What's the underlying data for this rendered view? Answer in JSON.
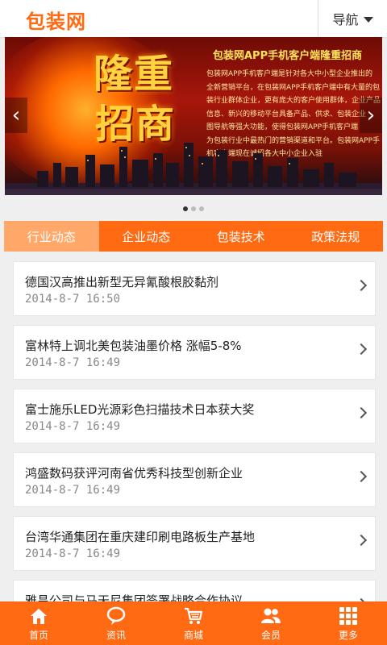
{
  "header": {
    "logo_text": "包装网",
    "nav_label": "导航"
  },
  "banner": {
    "headline_line1": "隆重",
    "headline_line2": "招商",
    "title": "包装网APP手机客户端隆重招商",
    "body": "包装网APP手机客户端是针对各大中小型企业推出的\n全新营销平台，在包装网APP手机客户端中有大量的包\n装行业群体企业，更有庞大的客户使用群体，企业产品\n信息、新兴的移动平台具备产品、供求、包装企业\n图导航等强大功能，使得包装网APP手机客户端\n为包装行业中最热门的营销渠道和平台。包装网APP手\n机客户端现在诚招各大中小企业入驻"
  },
  "tabs": [
    {
      "label": "行业动态",
      "active": true
    },
    {
      "label": "企业动态",
      "active": false
    },
    {
      "label": "包装技术",
      "active": false
    },
    {
      "label": "政策法规",
      "active": false
    }
  ],
  "news": [
    {
      "title": "德国汉高推出新型无异氰酸根胶黏剂",
      "date": "2014-8-7 16:50"
    },
    {
      "title": "富林特上调北美包装油墨价格 涨幅5-8%",
      "date": "2014-8-7 16:49"
    },
    {
      "title": "富士施乐LED光源彩色扫描技术日本获大奖",
      "date": "2014-8-7 16:49"
    },
    {
      "title": "鸿盛数码获评河南省优秀科技型创新企业",
      "date": "2014-8-7 16:49"
    },
    {
      "title": "台湾华通集团在重庆建印刷电路板生产基地",
      "date": "2014-8-7 16:49"
    },
    {
      "title": "雅昌公司与马天尼集团签署战略合作协议",
      "date": ""
    }
  ],
  "bottom_nav": [
    {
      "label": "首页",
      "icon": "home-icon"
    },
    {
      "label": "资讯",
      "icon": "chat-bubble-icon"
    },
    {
      "label": "商城",
      "icon": "cart-icon"
    },
    {
      "label": "会员",
      "icon": "users-icon"
    },
    {
      "label": "更多",
      "icon": "grid-icon"
    }
  ],
  "colors": {
    "accent": "#ff6a13",
    "tab_active": "#ffa86a"
  }
}
